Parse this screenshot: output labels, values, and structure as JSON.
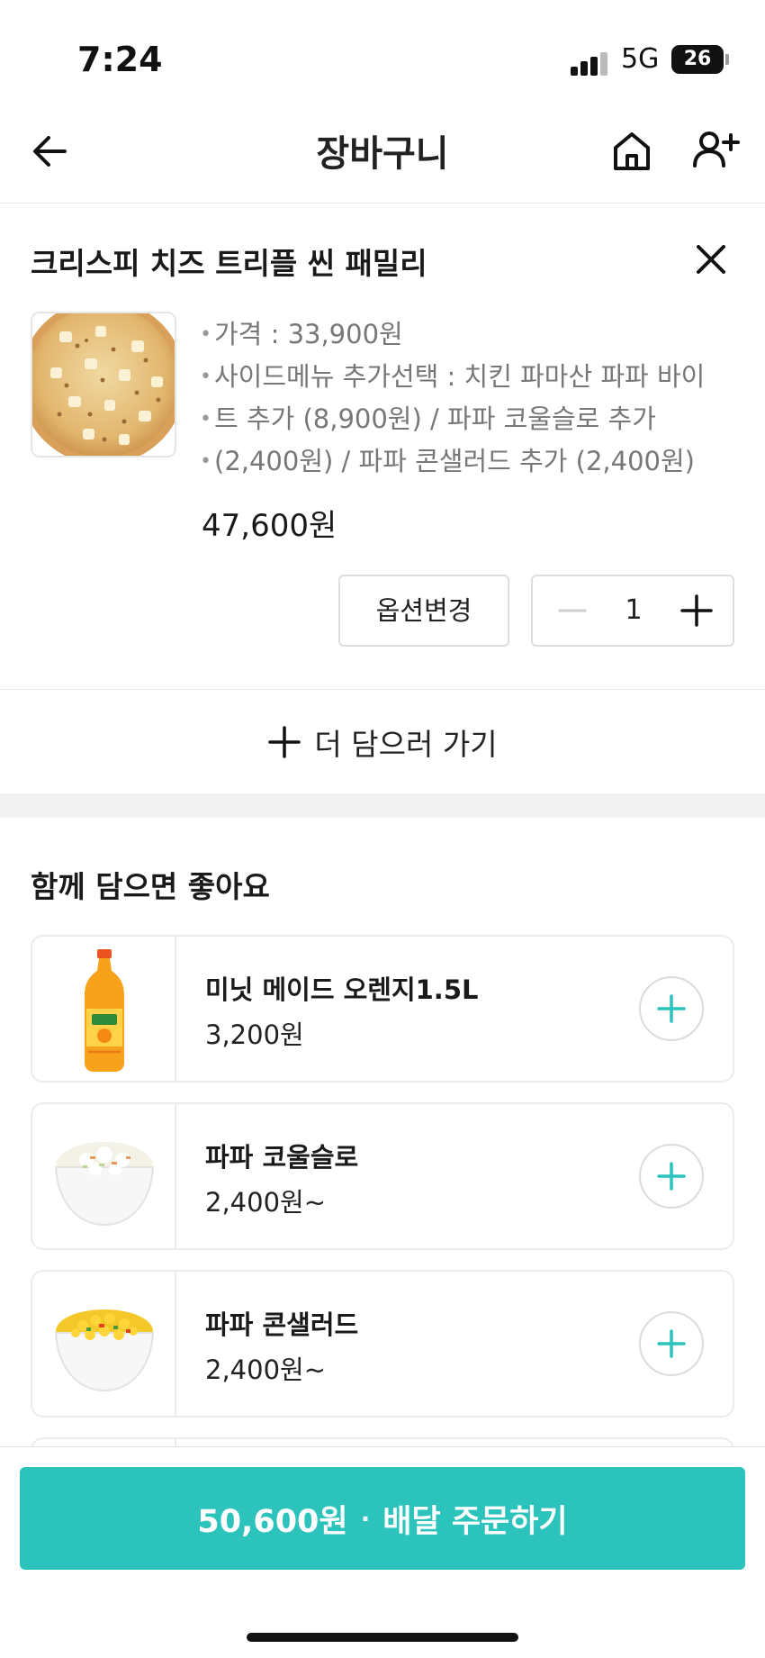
{
  "status_bar": {
    "time": "7:24",
    "network": "5G",
    "battery": "26"
  },
  "header": {
    "title": "장바구니",
    "icons": [
      "arrow-left-icon",
      "home-icon",
      "add-user-icon"
    ]
  },
  "cart_item": {
    "name": "크리스피 치즈 트리플 씬 패밀리",
    "image": "pizza",
    "options": [
      "가격 : 33,900원",
      "사이드메뉴 추가선택 : 치킨 파마산 파파 바이",
      "트 추가 (8,900원) / 파파 코울슬로 추가",
      "(2,400원) / 파파 콘샐러드 추가 (2,400원)"
    ],
    "total": "47,600원",
    "option_change_label": "옵션변경",
    "quantity": "1"
  },
  "add_more": {
    "label": "더 담으러 가기"
  },
  "recommendations": {
    "title": "함께 담으면 좋아요",
    "items": [
      {
        "name": "미닛 메이드 오렌지1.5L",
        "price": "3,200원",
        "image": "orange-juice-bottle"
      },
      {
        "name": "파파 코울슬로",
        "price": "2,400원~",
        "image": "coleslaw-bowl"
      },
      {
        "name": "파파 콘샐러드",
        "price": "2,400원~",
        "image": "corn-salad-bowl"
      }
    ]
  },
  "order_button": {
    "amount": "50,600원",
    "separator": "·",
    "label": "배달 주문하기"
  },
  "colors": {
    "accent": "#2cc3bd",
    "text": "#1a1a1a",
    "muted": "#777777",
    "border": "#ececec"
  }
}
